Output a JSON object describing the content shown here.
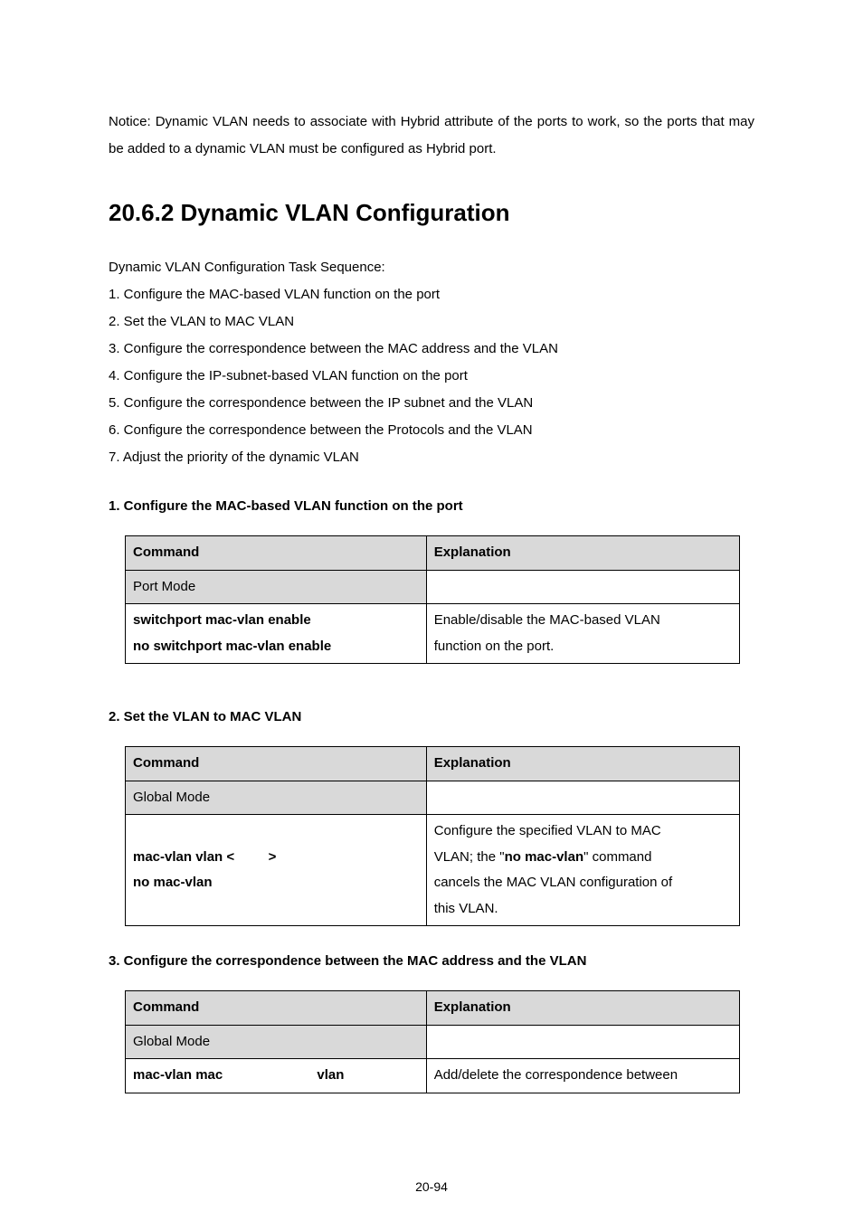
{
  "intro": "Notice: Dynamic VLAN needs to associate with Hybrid attribute of the ports to work, so the ports that may be added to a dynamic VLAN must be configured as Hybrid port.",
  "section_title": "20.6.2 Dynamic VLAN Configuration",
  "task_sequence_lead": "Dynamic VLAN Configuration Task Sequence:",
  "tasks": [
    "1. Configure the MAC-based VLAN function on the port",
    "2. Set the VLAN to MAC VLAN",
    "3. Configure the correspondence between the MAC address and the VLAN",
    "4. Configure the IP-subnet-based VLAN function on the port",
    "5. Configure the correspondence between the IP subnet and the VLAN",
    "6. Configure the correspondence between the Protocols and the VLAN",
    "7. Adjust the priority of the dynamic VLAN"
  ],
  "step1_title": "1. Configure the MAC-based VLAN function on the port",
  "table_headers": {
    "cmd": "Command",
    "exp": "Explanation"
  },
  "table1": {
    "mode": "Port Mode",
    "cmd_line1": "switchport mac-vlan enable",
    "cmd_line2": "no switchport mac-vlan enable",
    "exp_line1": "Enable/disable the MAC-based VLAN",
    "exp_line2": "function on the port."
  },
  "step2_title": "2. Set the VLAN to MAC VLAN",
  "table2": {
    "mode": "Global Mode",
    "cmd_prefix": "mac-vlan vlan <",
    "cmd_suffix": ">",
    "cmd_line2": "no mac-vlan",
    "exp_line1": "Configure the specified VLAN to MAC",
    "exp_line2a": "VLAN; the \"",
    "exp_line2b": "no mac-vlan",
    "exp_line2c": "\" command",
    "exp_line3": "cancels the MAC VLAN configuration of",
    "exp_line4": "this VLAN."
  },
  "step3_title": "3. Configure the correspondence between the MAC address and the VLAN",
  "table3": {
    "mode": "Global Mode",
    "cmd_part1": "mac-vlan mac",
    "cmd_part2": "vlan",
    "exp": "Add/delete the correspondence between"
  },
  "page_number": "20-94"
}
